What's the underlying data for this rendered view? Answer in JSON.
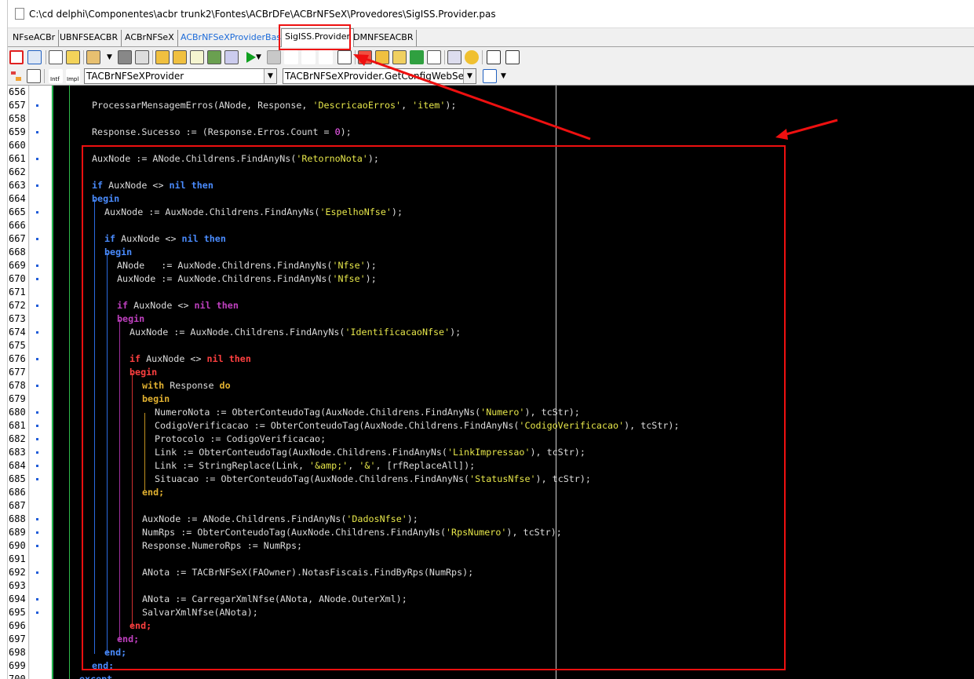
{
  "window": {
    "path": "C:\\cd delphi\\Componentes\\acbr trunk2\\Fontes\\ACBrDFe\\ACBrNFSeX\\Provedores\\SigISS.Provider.pas"
  },
  "tabs": [
    {
      "label": "NFseACBr"
    },
    {
      "label": "UBNFSEACBR"
    },
    {
      "label": "ACBrNFSeX"
    },
    {
      "label": "ACBrNFSeXProviderBase"
    },
    {
      "label": "SigISS.Provider"
    },
    {
      "label": "DMNFSEACBR"
    }
  ],
  "combos": {
    "class": "TACBrNFSeXProvider",
    "method": "TACBrNFSeXProvider.GetConfigWebServices"
  },
  "toolbar2_labels": {
    "intf": "Intf",
    "impl": "Impl"
  },
  "line_numbers": [
    "656",
    "657",
    "658",
    "659",
    "660",
    "661",
    "662",
    "663",
    "664",
    "665",
    "666",
    "667",
    "668",
    "669",
    "670",
    "671",
    "672",
    "673",
    "674",
    "675",
    "676",
    "677",
    "678",
    "679",
    "680",
    "681",
    "682",
    "683",
    "684",
    "685",
    "686",
    "687",
    "688",
    "689",
    "690",
    "691",
    "692",
    "693",
    "694",
    "695",
    "696",
    "697",
    "698",
    "699",
    "700"
  ],
  "code": {
    "l657": [
      "ProcessarMensagemErros(ANode, Response, ",
      "'DescricaoErros'",
      ", ",
      "'item'",
      ");"
    ],
    "l659": [
      "Response.Sucesso := (Response.Erros.Count = ",
      "0",
      ");"
    ],
    "l661": [
      "AuxNode := ANode.Childrens.FindAnyNs(",
      "'RetornoNota'",
      ");"
    ],
    "l663": [
      "if",
      " AuxNode <> ",
      "nil",
      " ",
      "then"
    ],
    "l664": "begin",
    "l665": [
      "AuxNode := AuxNode.Childrens.FindAnyNs(",
      "'EspelhoNfse'",
      ");"
    ],
    "l667": [
      "if",
      " AuxNode <> ",
      "nil",
      " ",
      "then"
    ],
    "l668": "begin",
    "l669": [
      "ANode   := AuxNode.Childrens.FindAnyNs(",
      "'Nfse'",
      ");"
    ],
    "l670": [
      "AuxNode := AuxNode.Childrens.FindAnyNs(",
      "'Nfse'",
      ");"
    ],
    "l672": [
      "if",
      " AuxNode <> ",
      "nil",
      " ",
      "then"
    ],
    "l673": "begin",
    "l674": [
      "AuxNode := AuxNode.Childrens.FindAnyNs(",
      "'IdentificacaoNfse'",
      ");"
    ],
    "l676": [
      "if",
      " AuxNode <> ",
      "nil",
      " ",
      "then"
    ],
    "l677": "begin",
    "l678": [
      "with",
      " Response ",
      "do"
    ],
    "l679": "begin",
    "l680": [
      "NumeroNota := ObterConteudoTag(AuxNode.Childrens.FindAnyNs(",
      "'Numero'",
      "), tcStr);"
    ],
    "l681": [
      "CodigoVerificacao := ObterConteudoTag(AuxNode.Childrens.FindAnyNs(",
      "'CodigoVerificacao'",
      "), tcStr);"
    ],
    "l682": "Protocolo := CodigoVerificacao;",
    "l683": [
      "Link := ObterConteudoTag(AuxNode.Childrens.FindAnyNs(",
      "'LinkImpressao'",
      "), tcStr);"
    ],
    "l684": [
      "Link := StringReplace(Link, ",
      "'&amp;'",
      ", ",
      "'&'",
      ", [rfReplaceAll]);"
    ],
    "l685": [
      "Situacao := ObterConteudoTag(AuxNode.Childrens.FindAnyNs(",
      "'StatusNfse'",
      "), tcStr);"
    ],
    "l686": "end;",
    "l688": [
      "AuxNode := ANode.Childrens.FindAnyNs(",
      "'DadosNfse'",
      ");"
    ],
    "l689": [
      "NumRps := ObterConteudoTag(AuxNode.Childrens.FindAnyNs(",
      "'RpsNumero'",
      "), tcStr);"
    ],
    "l690": "Response.NumeroRps := NumRps;",
    "l692": "ANota := TACBrNFSeX(FAOwner).NotasFiscais.FindByRps(NumRps);",
    "l694": "ANota := CarregarXmlNfse(ANota, ANode.OuterXml);",
    "l695": "SalvarXmlNfse(ANota);",
    "l696": "end;",
    "l697": "end;",
    "l698": "end;",
    "l699": "end;",
    "l700": "except"
  },
  "colors": {
    "editor_bg": "#000000",
    "keyword_blue": "#4a8cff",
    "keyword_purple": "#c040c0",
    "keyword_red": "#ff4040",
    "keyword_yellow": "#e0b030",
    "string": "#e6e64a",
    "annotation_red": "#ee1010"
  }
}
